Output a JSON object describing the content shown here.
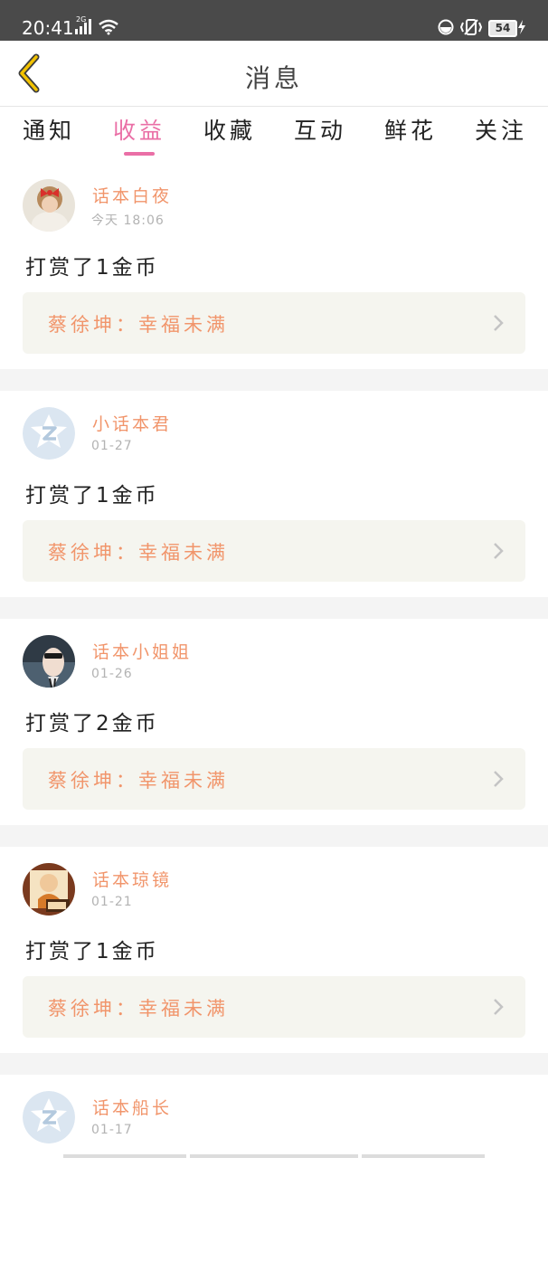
{
  "status_bar": {
    "time": "20:41",
    "network": "2G",
    "battery": "54"
  },
  "header": {
    "title": "消息"
  },
  "tabs": [
    {
      "label": "通知",
      "active": false
    },
    {
      "label": "收益",
      "active": true
    },
    {
      "label": "收藏",
      "active": false
    },
    {
      "label": "互动",
      "active": false
    },
    {
      "label": "鲜花",
      "active": false
    },
    {
      "label": "关注",
      "active": false
    }
  ],
  "messages": [
    {
      "username": "话本白夜",
      "time": "今天 18:06",
      "content": "打赏了1金币",
      "reference": "蔡徐坤：幸福未满",
      "avatar": "photo-girl"
    },
    {
      "username": "小话本君",
      "time": "01-27",
      "content": "打赏了1金币",
      "reference": "蔡徐坤：幸福未满",
      "avatar": "default-z"
    },
    {
      "username": "话本小姐姐",
      "time": "01-26",
      "content": "打赏了2金币",
      "reference": "蔡徐坤：幸福未满",
      "avatar": "photo-sunglasses"
    },
    {
      "username": "话本琼镜",
      "time": "01-21",
      "content": "打赏了1金币",
      "reference": "蔡徐坤：幸福未满",
      "avatar": "photo-cartoon"
    },
    {
      "username": "话本船长",
      "time": "01-17",
      "content": "",
      "reference": "",
      "avatar": "default-z"
    }
  ],
  "colors": {
    "accent": "#ea6fa6",
    "name": "#f1956b",
    "back": "#e8b400"
  }
}
